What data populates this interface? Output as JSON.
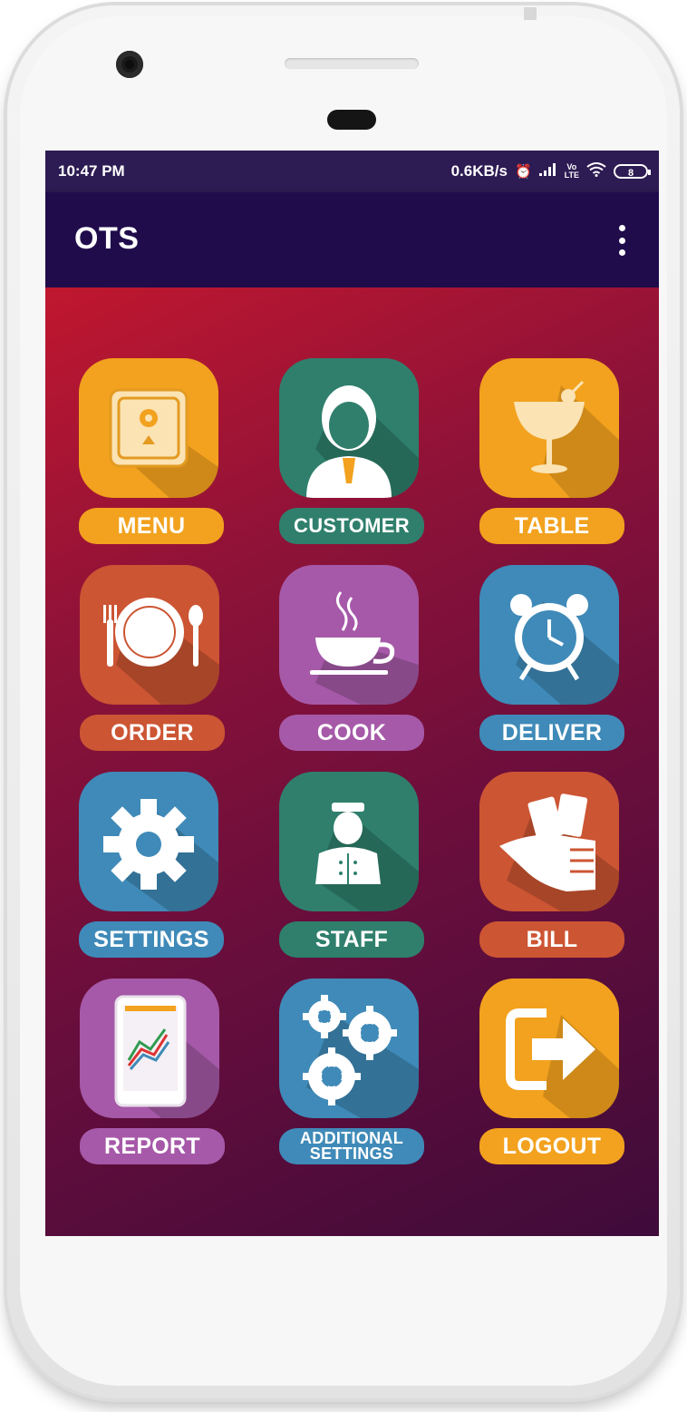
{
  "status": {
    "time": "10:47 PM",
    "network_speed": "0.6KB/s",
    "battery": "8"
  },
  "appbar": {
    "title": "OTS"
  },
  "tiles": [
    {
      "label": "MENU",
      "color": "#f2a21e",
      "icon": "safe-icon"
    },
    {
      "label": "CUSTOMER",
      "color": "#2f7f6c",
      "icon": "customer-icon"
    },
    {
      "label": "TABLE",
      "color": "#f2a21e",
      "icon": "cocktail-icon"
    },
    {
      "label": "ORDER",
      "color": "#cc5533",
      "icon": "plate-cutlery-icon"
    },
    {
      "label": "COOK",
      "color": "#a659a8",
      "icon": "coffee-cup-icon"
    },
    {
      "label": "DELIVER",
      "color": "#3f8ab8",
      "icon": "alarm-clock-icon"
    },
    {
      "label": "SETTINGS",
      "color": "#3f8ab8",
      "icon": "gear-icon"
    },
    {
      "label": "STAFF",
      "color": "#2f7f6c",
      "icon": "staff-icon"
    },
    {
      "label": "BILL",
      "color": "#cc5533",
      "icon": "money-hand-icon"
    },
    {
      "label": "REPORT",
      "color": "#a659a8",
      "icon": "report-tablet-icon"
    },
    {
      "label": "ADDITIONAL SETTINGS",
      "color": "#3f8ab8",
      "icon": "gears-icon"
    },
    {
      "label": "LOGOUT",
      "color": "#f2a21e",
      "icon": "logout-icon"
    }
  ]
}
